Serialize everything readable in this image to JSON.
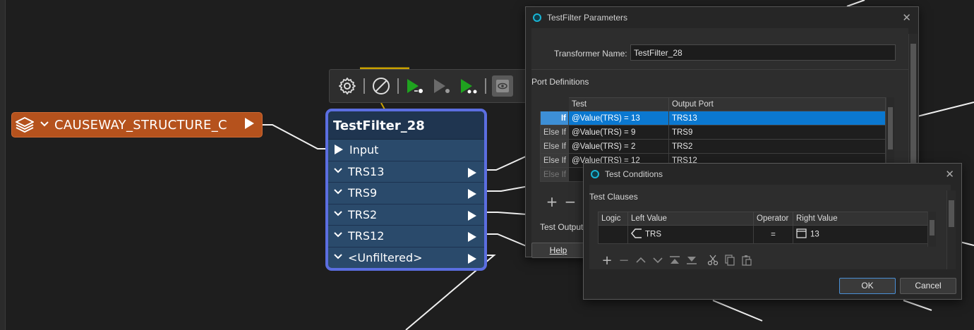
{
  "reader": {
    "title": "CAUSEWAY_STRUCTURE_C"
  },
  "transformer": {
    "title": "TestFilter_28",
    "input_port": "Input",
    "output_ports": [
      "TRS13",
      "TRS9",
      "TRS2",
      "TRS12",
      "<Unfiltered>"
    ]
  },
  "toolbar": {
    "icons": [
      "gear-icon",
      "disable-icon",
      "run-to-icon",
      "run-from-icon",
      "run-one-icon",
      "inspect-icon"
    ]
  },
  "params_dialog": {
    "title": "TestFilter Parameters",
    "transformer_name_label": "Transformer Name:",
    "transformer_name_value": "TestFilter_28",
    "port_definitions_label": "Port Definitions",
    "columns": [
      "Test",
      "Output Port"
    ],
    "rows": [
      {
        "kind": "If",
        "test": "@Value(TRS) = 13",
        "port": "TRS13",
        "selected": true
      },
      {
        "kind": "Else If",
        "test": "@Value(TRS) = 9",
        "port": "TRS9"
      },
      {
        "kind": "Else If",
        "test": "@Value(TRS) = 2",
        "port": "TRS2"
      },
      {
        "kind": "Else If",
        "test": "@Value(TRS) = 12",
        "port": "TRS12"
      },
      {
        "kind": "Else If",
        "test": "",
        "port": ""
      }
    ],
    "test_output_label": "Test Output",
    "help_label": "Help"
  },
  "conditions_dialog": {
    "title": "Test Conditions",
    "clauses_label": "Test Clauses",
    "columns": [
      "Logic",
      "Left Value",
      "Operator",
      "Right Value"
    ],
    "row": {
      "logic": "",
      "left": "TRS",
      "operator": "=",
      "right": "13"
    },
    "ok_label": "OK",
    "cancel_label": "Cancel"
  },
  "colors": {
    "reader_fill": "#b5521d",
    "transformer_fill": "#2a4a6b",
    "transformer_border": "#5b6ee1",
    "selection": "#0b78d0",
    "run_green": "#1fa31f"
  }
}
